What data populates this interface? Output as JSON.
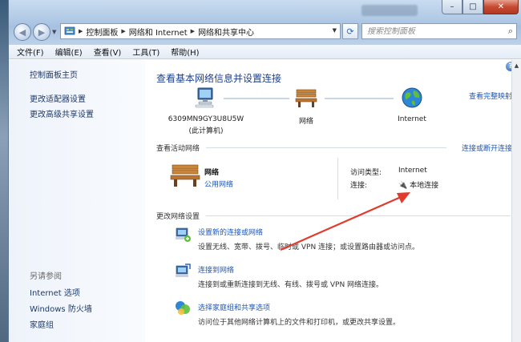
{
  "window": {
    "caption_buttons": {
      "minimize": "–",
      "maximize": "□",
      "close": "✕"
    }
  },
  "nav": {
    "breadcrumbs": [
      "控制面板",
      "网络和 Internet",
      "网络和共享中心"
    ],
    "search_placeholder": "搜索控制面板"
  },
  "menu": [
    "文件(F)",
    "编辑(E)",
    "查看(V)",
    "工具(T)",
    "帮助(H)"
  ],
  "sidebar": {
    "links": [
      "控制面板主页",
      "更改适配器设置",
      "更改高级共享设置"
    ],
    "see_also_heading": "另请参阅",
    "see_also": [
      "Internet 选项",
      "Windows 防火墙",
      "家庭组"
    ]
  },
  "main": {
    "title": "查看基本网络信息并设置连接",
    "view_full_map": "查看完整映射",
    "nodes": [
      {
        "line1": "6309MN9GY3U8U5W",
        "line2": "(此计算机)",
        "icon": "computer-icon"
      },
      {
        "line1": "网络",
        "line2": "",
        "icon": "bench-icon"
      },
      {
        "line1": "Internet",
        "line2": "",
        "icon": "globe-icon"
      }
    ],
    "active_networks_label": "查看活动网络",
    "connect_disconnect": "连接或断开连接",
    "active_network": {
      "name": "网络",
      "type": "公用网络",
      "access_type_label": "访问类型:",
      "access_type_value": "Internet",
      "connections_label": "连接:",
      "connections_value": "本地连接"
    },
    "change_settings_label": "更改网络设置",
    "tasks": [
      {
        "link": "设置新的连接或网络",
        "desc": "设置无线、宽带、拨号、临时或 VPN 连接；或设置路由器或访问点。",
        "icon": "new-connection-icon"
      },
      {
        "link": "连接到网络",
        "desc": "连接到或重新连接到无线、有线、拨号或 VPN 网络连接。",
        "icon": "connect-network-icon"
      },
      {
        "link": "选择家庭组和共享选项",
        "desc": "访问位于其他网络计算机上的文件和打印机，或更改共享设置。",
        "icon": "homegroup-icon"
      }
    ]
  },
  "colors": {
    "link": "#1f57b8",
    "title": "#1d3f8c",
    "annotation_arrow": "#e23b2e"
  }
}
